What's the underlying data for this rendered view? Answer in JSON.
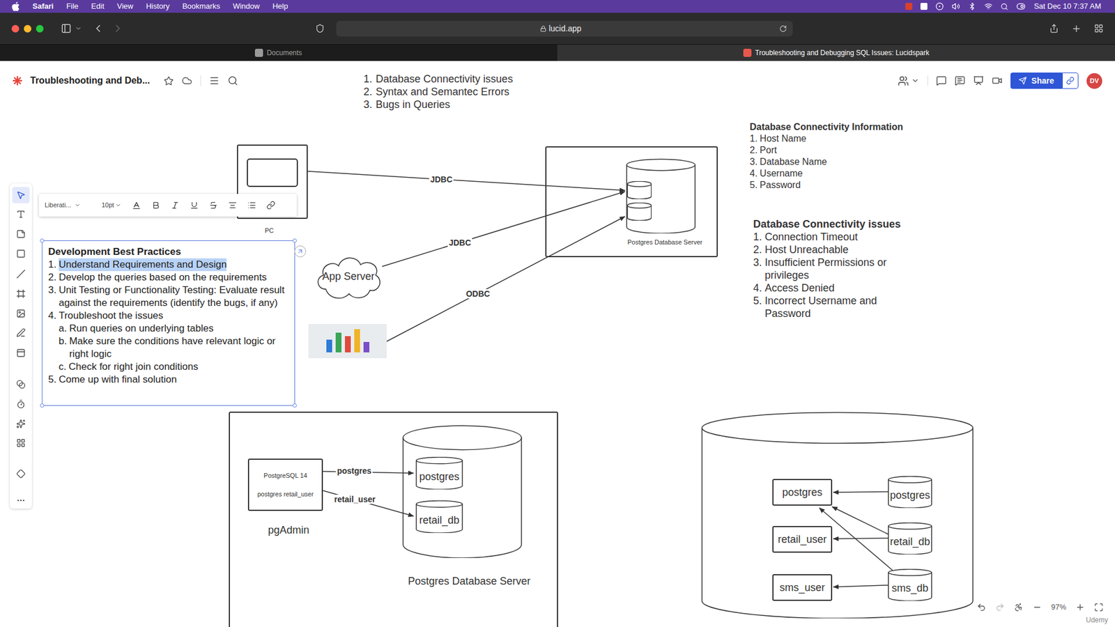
{
  "menubar": {
    "app": "Safari",
    "items": [
      "File",
      "Edit",
      "View",
      "History",
      "Bookmarks",
      "Window",
      "Help"
    ],
    "clock": "Sat Dec 10 7:37 AM"
  },
  "browser": {
    "url": "lucid.app",
    "tabs": [
      {
        "label": "Documents",
        "selected": false
      },
      {
        "label": "Troubleshooting and Debugging SQL Issues: Lucidspark",
        "selected": true
      }
    ]
  },
  "header": {
    "title": "Troubleshooting and Deb...",
    "share": "Share",
    "avatar": "DV"
  },
  "tools": [
    {
      "tool": "select",
      "selected": true
    },
    {
      "tool": "text",
      "selected": false
    },
    {
      "tool": "sticky",
      "selected": false
    },
    {
      "tool": "shape",
      "selected": false
    },
    {
      "tool": "line",
      "selected": false
    },
    {
      "tool": "frame",
      "selected": false
    },
    {
      "tool": "image",
      "selected": false
    },
    {
      "tool": "draw",
      "selected": false
    },
    {
      "tool": "card",
      "selected": false
    },
    {
      "tool": "blend",
      "selected": false
    },
    {
      "tool": "timer",
      "selected": false
    },
    {
      "tool": "stars",
      "selected": false
    },
    {
      "tool": "grid",
      "selected": false
    },
    {
      "tool": "diamond",
      "selected": false
    },
    {
      "tool": "more",
      "selected": false
    }
  ],
  "format_toolbar": {
    "font": "Liberati...",
    "size": "10pt"
  },
  "topics": [
    {
      "number": "1.",
      "text": "Database Connectivity issues"
    },
    {
      "number": "2.",
      "text": "Syntax and Semantec Errors"
    },
    {
      "number": "3.",
      "text": "Bugs in Queries"
    }
  ],
  "connectivity_info": {
    "title": "Database Connectivity Information",
    "items": [
      {
        "number": "1.",
        "text": "Host Name"
      },
      {
        "number": "2.",
        "text": "Port"
      },
      {
        "number": "3.",
        "text": "Database Name"
      },
      {
        "number": "4.",
        "text": "Username"
      },
      {
        "number": "5.",
        "text": "Password"
      }
    ]
  },
  "connectivity_issues": {
    "title": "Database Connectivity issues",
    "items": [
      {
        "number": "1.",
        "text": "Connection Timeout"
      },
      {
        "number": "2.",
        "text": "Host Unreachable"
      },
      {
        "number": "3.",
        "text": "Insufficient Permissions or privileges"
      },
      {
        "number": "4.",
        "text": "Access Denied"
      },
      {
        "number": "5.",
        "text": "Incorrect Username and Password"
      }
    ]
  },
  "best_practices": {
    "title": "Development Best Practices",
    "items": [
      {
        "kind": "step",
        "number": "1.",
        "text": "Understand Requirements and Design",
        "highlighted": true
      },
      {
        "kind": "step",
        "number": "2.",
        "text": "Develop the queries based on the requirements",
        "highlighted": false
      },
      {
        "kind": "step",
        "number": "3.",
        "text": "Unit Testing or Functionality Testing: Evaluate result against the requirements (identify the bugs, if any)",
        "highlighted": false
      },
      {
        "kind": "step",
        "number": "4.",
        "text": "Troubleshoot the issues",
        "highlighted": false
      },
      {
        "kind": "substep",
        "number": "a.",
        "text": "Run queries on underlying tables",
        "highlighted": false
      },
      {
        "kind": "substep",
        "number": "b.",
        "text": "Make sure the conditions have relevant logic or right logic",
        "highlighted": false
      },
      {
        "kind": "substep",
        "number": "c.",
        "text": "Check for right join conditions",
        "highlighted": false
      },
      {
        "kind": "step",
        "number": "5.",
        "text": "Come up with final solution",
        "highlighted": false
      }
    ]
  },
  "network_diagram": {
    "pc_label": "PC",
    "app_server": "App Server",
    "server_label": "Postgres Database Server",
    "connections": [
      {
        "label": "JDBC"
      },
      {
        "label": "JDBC"
      },
      {
        "label": "ODBC"
      }
    ]
  },
  "pgadmin_diagram": {
    "client_lines": [
      "PostgreSQL 14",
      "postgres retail_user"
    ],
    "client_label": "pgAdmin",
    "connections": [
      {
        "label": "postgres"
      },
      {
        "label": "retail_user"
      }
    ],
    "databases": [
      "postgres",
      "retail_db"
    ],
    "server_label": "Postgres Database Server"
  },
  "roles_diagram": {
    "roles": [
      "postgres",
      "retail_user",
      "sms_user"
    ],
    "databases": [
      "postgres",
      "retail_db",
      "sms_db"
    ]
  },
  "zoom": {
    "value": "97%"
  },
  "watermark": "Udemy"
}
